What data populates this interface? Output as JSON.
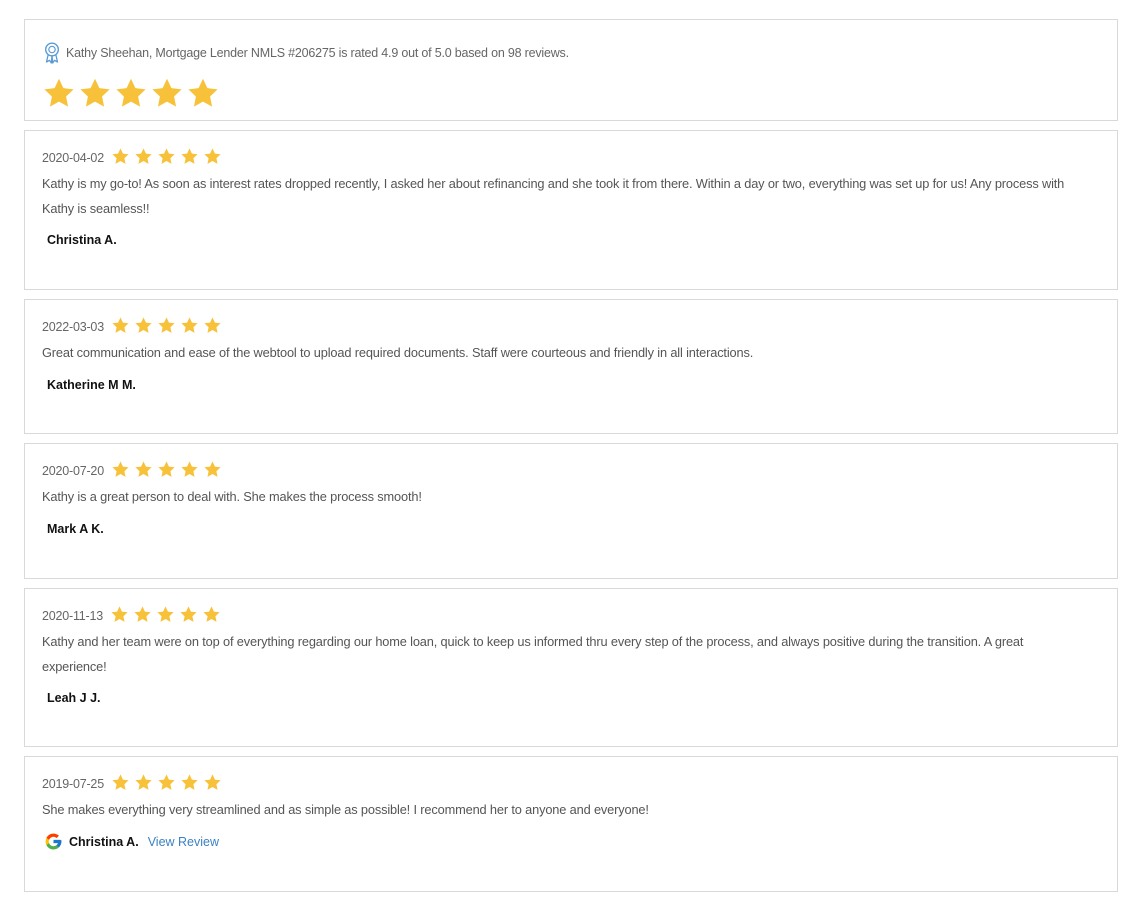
{
  "summary": {
    "text": "Kathy Sheehan, Mortgage Lender NMLS #206275 is rated 4.9 out of 5.0 based on 98 reviews.",
    "icon": "award-ribbon-icon",
    "stars": 5
  },
  "colors": {
    "star": "#f7c23a",
    "link": "#3b82c4",
    "border": "#d9d9d9",
    "award_icon": "#5b9bd5"
  },
  "reviews": [
    {
      "date": "2020-04-02",
      "rating": 5,
      "text": "Kathy is my go-to! As soon as interest rates dropped recently, I asked her about refinancing and she took it from there. Within a day or two, everything was set up for us! Any process with Kathy is seamless!!",
      "author": "Christina A."
    },
    {
      "date": "2022-03-03",
      "rating": 5,
      "text": "Great communication and ease of the webtool to upload required documents. Staff were courteous and friendly in all interactions.",
      "author": "Katherine M M."
    },
    {
      "date": "2020-07-20",
      "rating": 5,
      "text": "Kathy is a great person to deal with. She makes the process smooth!",
      "author": "Mark A K."
    },
    {
      "date": "2020-11-13",
      "rating": 5,
      "text": "Kathy and her team were on top of everything regarding our home loan, quick to keep us informed thru every step of the process, and always positive during the transition. A great experience!",
      "author": "Leah J J."
    },
    {
      "date": "2019-07-25",
      "rating": 5,
      "text": "She makes everything very streamlined and as simple as possible! I recommend her to anyone and everyone!",
      "author": "Christina A.",
      "source_icon": "google-icon",
      "link_label": "View Review"
    }
  ]
}
